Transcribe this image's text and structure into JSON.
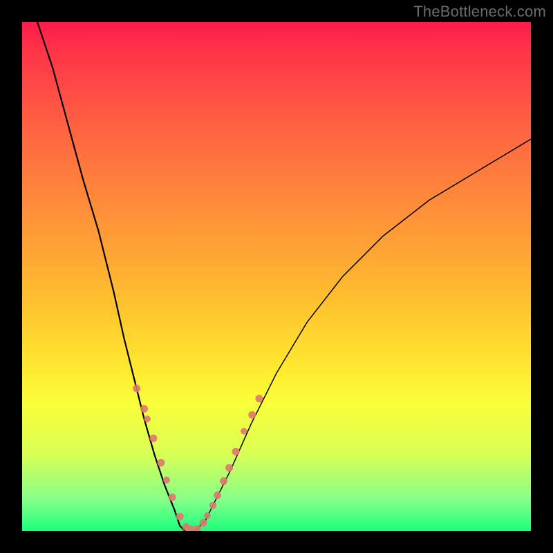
{
  "watermark": "TheBottleneck.com",
  "chart_data": {
    "type": "line",
    "title": "",
    "xlabel": "",
    "ylabel": "",
    "xlim": [
      0,
      100
    ],
    "ylim": [
      0,
      100
    ],
    "series": [
      {
        "name": "curve-left",
        "x": [
          3,
          6,
          9,
          12,
          15,
          18,
          20,
          22,
          24,
          26,
          28,
          30,
          31,
          32
        ],
        "values": [
          100,
          91,
          80,
          69,
          59,
          47,
          38,
          30,
          22,
          15,
          9,
          4,
          1,
          0
        ]
      },
      {
        "name": "curve-right",
        "x": [
          34,
          36,
          38,
          41,
          45,
          50,
          56,
          63,
          71,
          80,
          90,
          100
        ],
        "values": [
          0,
          2,
          6,
          12,
          21,
          31,
          41,
          50,
          58,
          65,
          71,
          77
        ]
      }
    ],
    "highlight_points": {
      "name": "pink-dots",
      "x": [
        22.5,
        24.0,
        24.6,
        25.8,
        27.3,
        28.4,
        29.5,
        31.0,
        32.2,
        33.2,
        34.4,
        35.6,
        36.4,
        37.5,
        38.4,
        39.6,
        40.7,
        42.0,
        43.6,
        45.2,
        46.6
      ],
      "values": [
        28.0,
        24.0,
        22.0,
        18.2,
        13.4,
        10.0,
        6.6,
        2.8,
        0.8,
        0.4,
        0.4,
        1.6,
        3.0,
        5.0,
        7.0,
        9.8,
        12.4,
        15.6,
        19.6,
        22.8,
        26.0
      ],
      "radius": [
        5.5,
        5.5,
        4.8,
        5.5,
        5.5,
        5.0,
        5.5,
        5.5,
        5.5,
        5.0,
        5.5,
        5.5,
        5.0,
        5.2,
        5.5,
        5.5,
        5.5,
        5.5,
        4.8,
        5.5,
        5.5
      ]
    },
    "background_gradient": [
      "#ff1c4b",
      "#ffae34",
      "#fff53c",
      "#1aff7c"
    ]
  }
}
